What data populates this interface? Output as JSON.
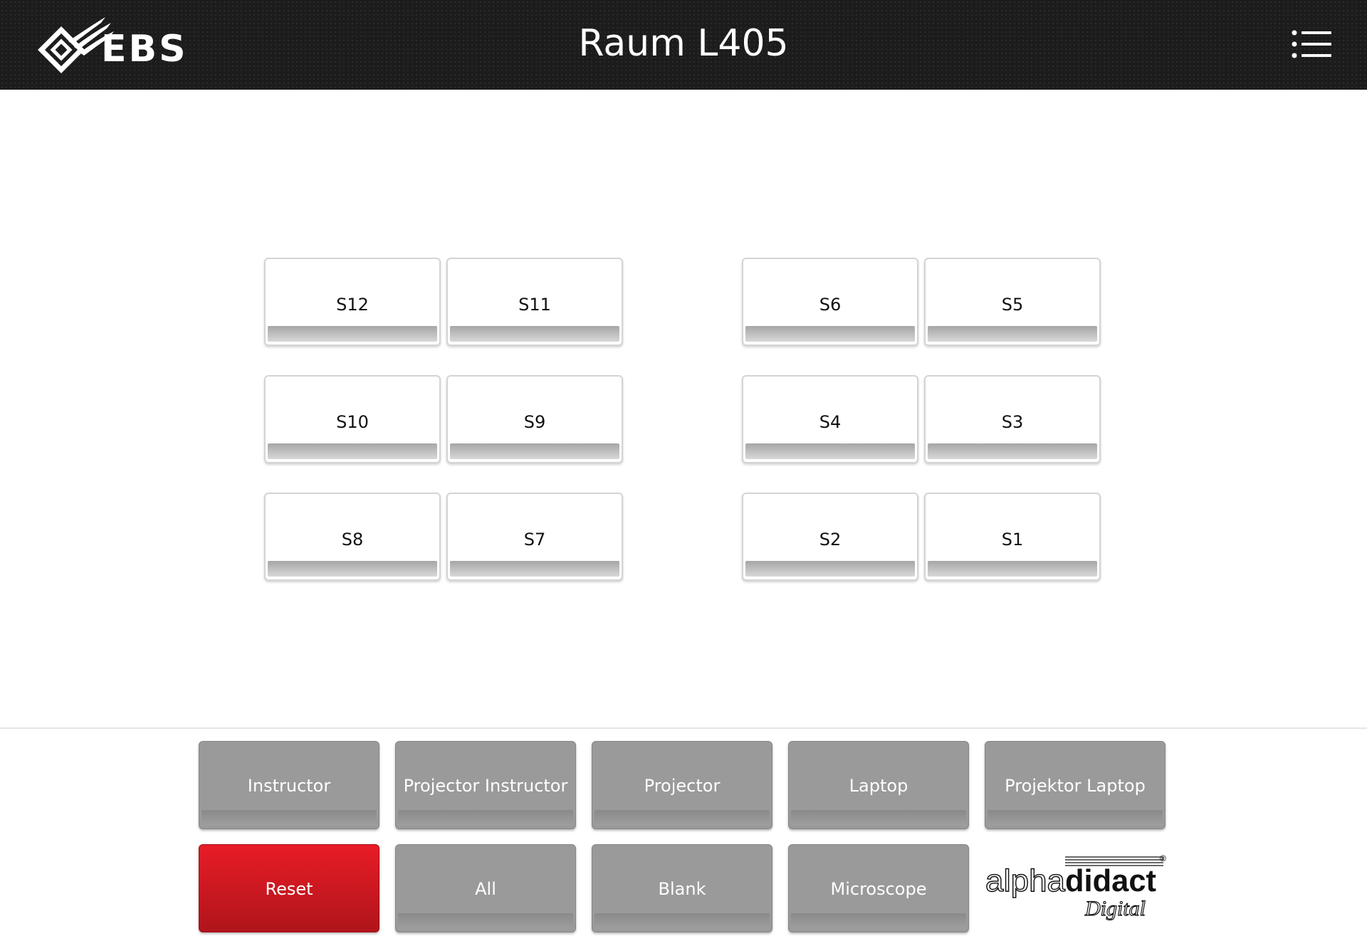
{
  "header": {
    "title": "Raum L405",
    "logo_text": "EBS",
    "menu_icon": "list-menu-icon"
  },
  "stations": {
    "left": [
      [
        "S12",
        "S11"
      ],
      [
        "S10",
        "S9"
      ],
      [
        "S8",
        "S7"
      ]
    ],
    "right": [
      [
        "S6",
        "S5"
      ],
      [
        "S4",
        "S3"
      ],
      [
        "S2",
        "S1"
      ]
    ]
  },
  "sources": {
    "row1": [
      "Instructor",
      "Projector Instructor",
      "Projector",
      "Laptop",
      "Projektor Laptop"
    ],
    "row2": [
      "Reset",
      "All",
      "Blank",
      "Microscope"
    ]
  },
  "brand": {
    "name_light": "alpha",
    "name_bold": "didact",
    "sub": "Digital",
    "registered": "®"
  },
  "colors": {
    "header_bg": "#1c1c1c",
    "tile_bar": "#a6a6a6",
    "source_bg": "#9a9a9a",
    "reset_bg": "#e81c26"
  }
}
